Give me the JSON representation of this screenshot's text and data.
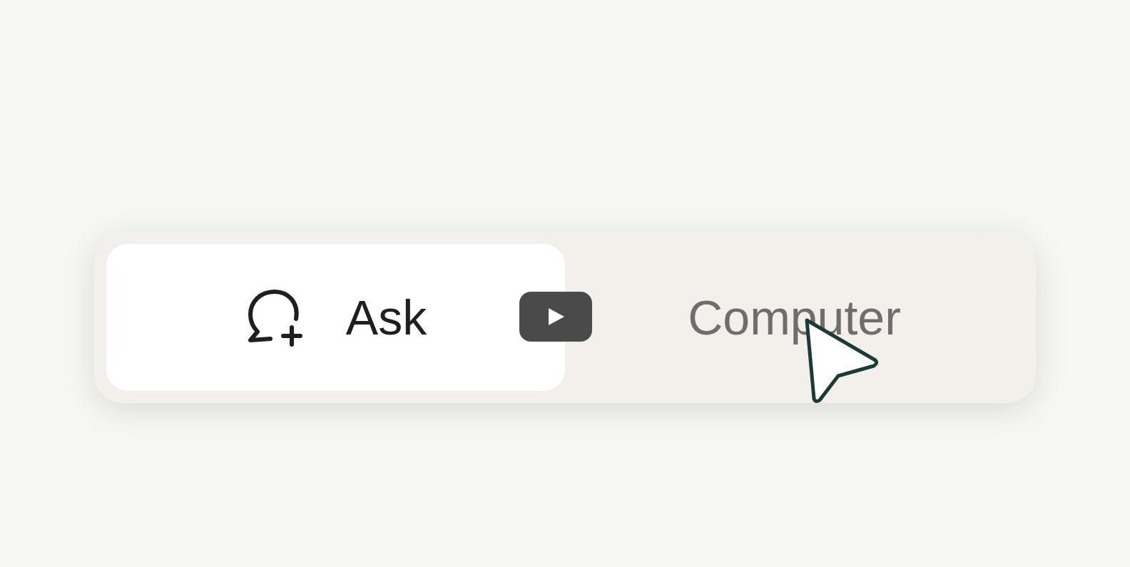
{
  "tabs": [
    {
      "label": "Ask",
      "selected": true,
      "kind": "chat"
    },
    {
      "label": "Computer",
      "selected": false,
      "kind": "plain"
    }
  ]
}
